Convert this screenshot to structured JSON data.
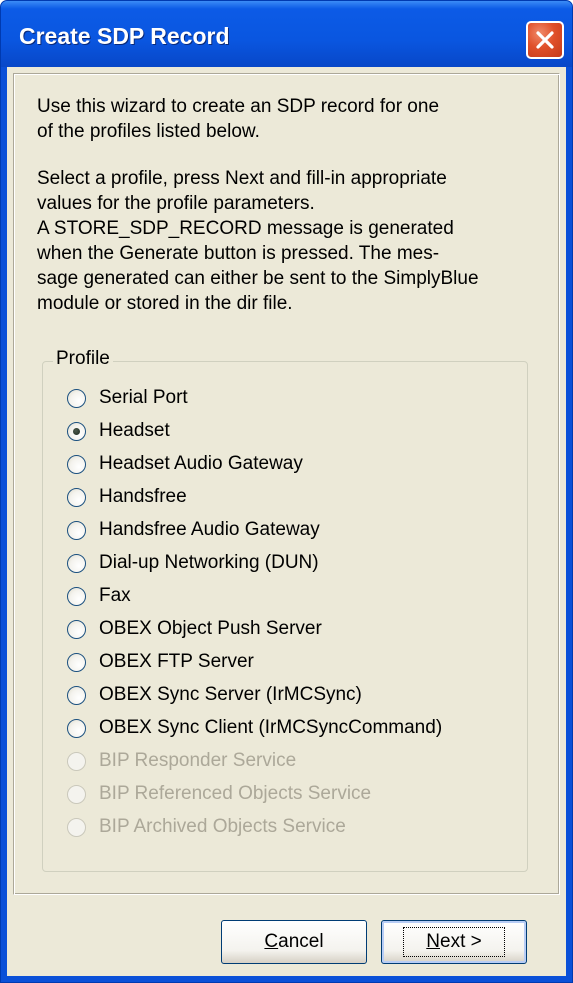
{
  "window": {
    "title": "Create SDP Record"
  },
  "description": {
    "para1": [
      "Use this wizard to create an SDP record for one",
      "of the profiles listed below."
    ],
    "para2": [
      "Select a profile, press Next and fill-in appropriate",
      "values for the profile parameters.",
      "A STORE_SDP_RECORD message is generated",
      "when the Generate button is pressed. The mes-",
      "sage generated can either be sent to the SimplyBlue",
      "module or stored in the dir file."
    ]
  },
  "profile_group": {
    "label": "Profile",
    "options": [
      {
        "label": "Serial Port",
        "selected": false,
        "enabled": true
      },
      {
        "label": "Headset",
        "selected": true,
        "enabled": true
      },
      {
        "label": "Headset Audio Gateway",
        "selected": false,
        "enabled": true
      },
      {
        "label": "Handsfree",
        "selected": false,
        "enabled": true
      },
      {
        "label": "Handsfree Audio Gateway",
        "selected": false,
        "enabled": true
      },
      {
        "label": "Dial-up Networking (DUN)",
        "selected": false,
        "enabled": true
      },
      {
        "label": "Fax",
        "selected": false,
        "enabled": true
      },
      {
        "label": "OBEX Object Push Server",
        "selected": false,
        "enabled": true
      },
      {
        "label": "OBEX FTP Server",
        "selected": false,
        "enabled": true
      },
      {
        "label": "OBEX Sync Server (IrMCSync)",
        "selected": false,
        "enabled": true
      },
      {
        "label": "OBEX Sync Client (IrMCSyncCommand)",
        "selected": false,
        "enabled": true
      },
      {
        "label": "BIP Responder Service",
        "selected": false,
        "enabled": false
      },
      {
        "label": "BIP Referenced Objects Service",
        "selected": false,
        "enabled": false
      },
      {
        "label": "BIP Archived Objects Service",
        "selected": false,
        "enabled": false
      }
    ]
  },
  "buttons": {
    "cancel": {
      "mnemonic": "C",
      "rest": "ancel"
    },
    "next": {
      "mnemonic": "N",
      "rest": "ext >"
    }
  },
  "icons": {
    "close": "close-icon",
    "radio": "radio-button-icon"
  },
  "colors": {
    "title_bar": "#0a56e0",
    "close_button": "#e0502a",
    "dialog_face": "#ece9d8",
    "disabled_text": "#aca899"
  }
}
